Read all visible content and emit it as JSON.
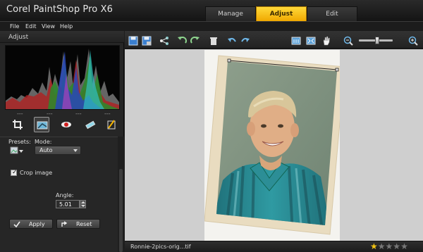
{
  "app": {
    "title": "Corel PaintShop Pro X6"
  },
  "tabs": [
    {
      "label": "Manage",
      "active": false
    },
    {
      "label": "Adjust",
      "active": true
    },
    {
      "label": "Edit",
      "active": false
    }
  ],
  "menu": [
    {
      "label": "File"
    },
    {
      "label": "Edit"
    },
    {
      "label": "View"
    },
    {
      "label": "Help"
    }
  ],
  "panel": {
    "title": "Adjust",
    "histogram_readouts": [
      "---",
      "---",
      "---",
      "---"
    ],
    "tools": [
      {
        "icon": "crop-icon",
        "active": false
      },
      {
        "icon": "straighten-icon",
        "active": true
      },
      {
        "icon": "red-eye-icon",
        "active": false
      },
      {
        "icon": "retouch-brush-icon",
        "active": false
      },
      {
        "icon": "smart-carver-icon",
        "active": false
      }
    ],
    "presets_label": "Presets:",
    "mode_label": "Mode:",
    "mode_value": "Auto",
    "angle_label": "Angle:",
    "angle_value": "5.01",
    "crop_image_label": "Crop image",
    "crop_image_checked": true,
    "apply_label": "Apply",
    "reset_label": "Reset"
  },
  "toolbar": {
    "icons": [
      "save-icon",
      "save-as-icon",
      "share-icon",
      "rotate-left-icon",
      "rotate-right-icon",
      "delete-icon",
      "undo-icon",
      "redo-icon",
      "actual-size-icon",
      "fit-window-icon",
      "pan-hand-icon",
      "zoom-out-icon",
      "zoom-in-icon"
    ],
    "zoom_level": 0.5
  },
  "status": {
    "file_name": "Ronnie-2pics-orig...tif",
    "rating": 1,
    "rating_max": 5
  },
  "colors": {
    "accent": "#f5b400",
    "background": "#1e1e1e",
    "canvas": "#cfcfcf"
  }
}
